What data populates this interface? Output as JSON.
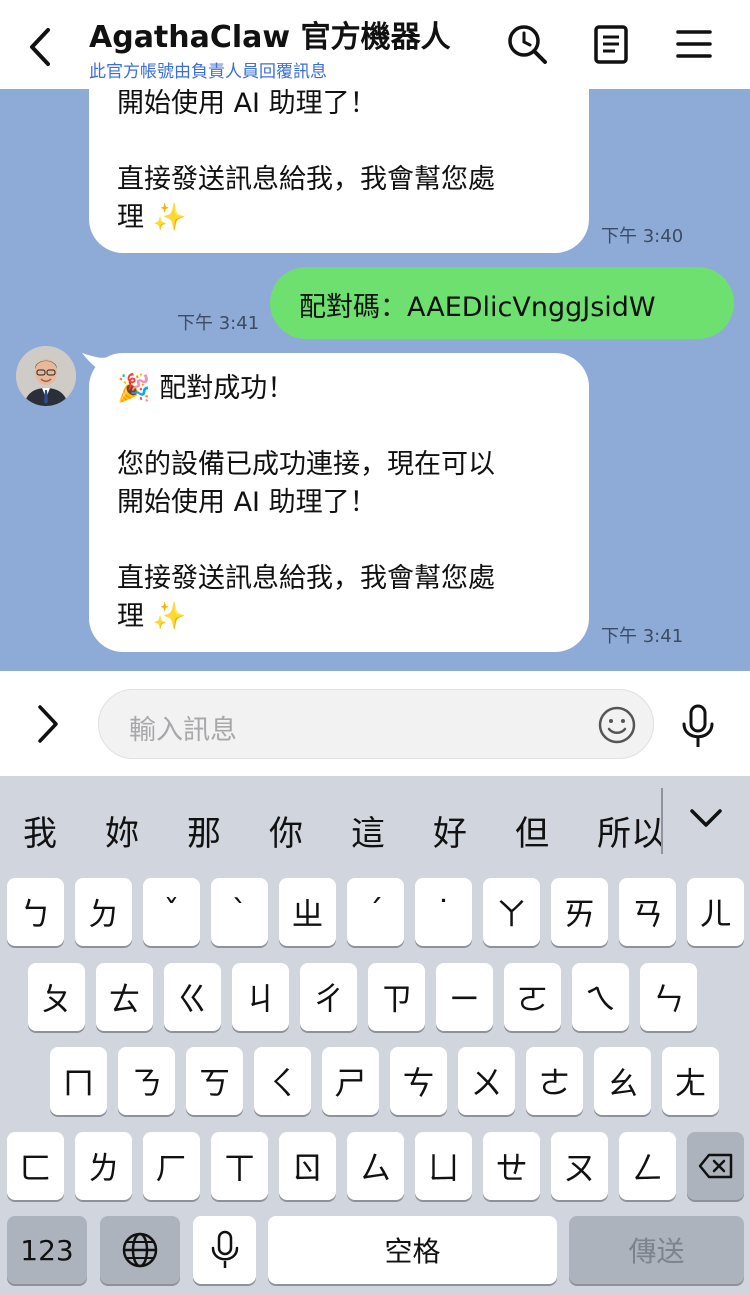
{
  "header": {
    "title": "AgathaClaw 官方機器人",
    "subtitle": "此官方帳號由負責人員回覆訊息",
    "icons": [
      "back-chevron-icon",
      "search-icon",
      "notes-icon",
      "menu-icon"
    ]
  },
  "messages": {
    "first": {
      "lines": [
        "開始使用 AI 助理了！",
        "",
        "直接發送訊息給我，我會幫您處",
        "理 ✨"
      ],
      "time": "下午 3:40"
    },
    "pairing": {
      "text": "配對碼：AAEDlicVnggJsidW",
      "time": "下午 3:41"
    },
    "success": {
      "lines": [
        "🎉 配對成功！",
        "",
        "您的設備已成功連接，現在可以",
        "開始使用 AI 助理了！",
        "",
        "直接發送訊息給我，我會幫您處",
        "理 ✨"
      ],
      "time": "下午 3:41"
    }
  },
  "composer": {
    "placeholder": "輸入訊息"
  },
  "keyboard": {
    "suggestions": [
      "我",
      "妳",
      "那",
      "你",
      "這",
      "好",
      "但",
      "所以"
    ],
    "row1": [
      "ㄅ",
      "ㄉ",
      "ˇ",
      "ˋ",
      "ㄓ",
      "ˊ",
      "˙",
      "ㄚ",
      "ㄞ",
      "ㄢ",
      "ㄦ"
    ],
    "row2": [
      "ㄆ",
      "ㄊ",
      "ㄍ",
      "ㄐ",
      "ㄔ",
      "ㄗ",
      "ㄧ",
      "ㄛ",
      "ㄟ",
      "ㄣ"
    ],
    "row3": [
      "ㄇ",
      "ㄋ",
      "ㄎ",
      "ㄑ",
      "ㄕ",
      "ㄘ",
      "ㄨ",
      "ㄜ",
      "ㄠ",
      "ㄤ"
    ],
    "row4": [
      "ㄈ",
      "ㄌ",
      "ㄏ",
      "ㄒ",
      "ㄖ",
      "ㄙ",
      "ㄩ",
      "ㄝ",
      "ㄡ",
      "ㄥ"
    ],
    "numbers_label": "123",
    "space_label": "空格",
    "send_label": "傳送"
  }
}
